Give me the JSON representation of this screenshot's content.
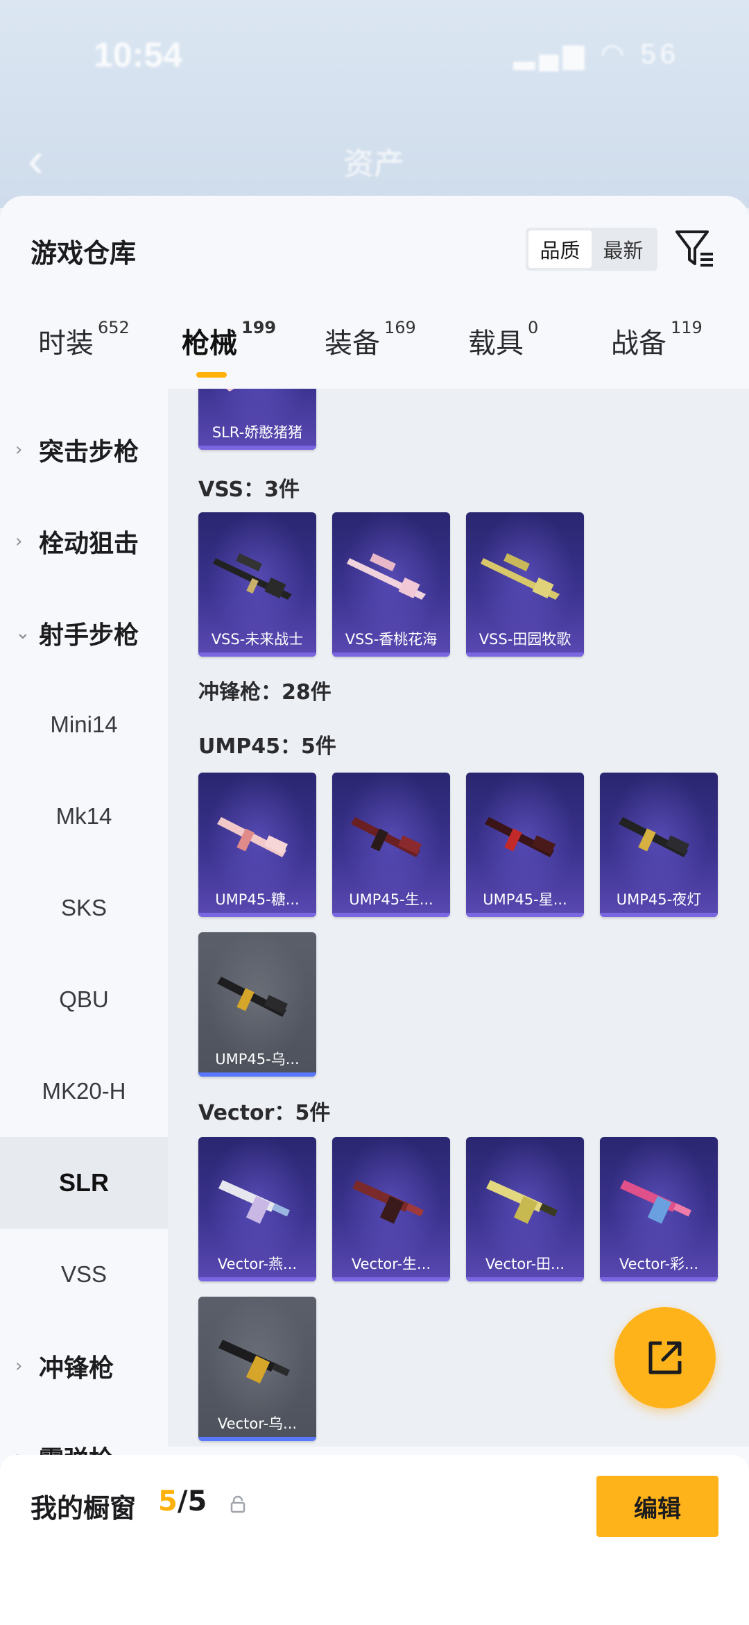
{
  "status_bar": {
    "time": "10:54",
    "right_icons": "▂▄▆ ◠ 56"
  },
  "nav": {
    "back_glyph": "‹",
    "title": "资产"
  },
  "sheet": {
    "title": "游戏仓库",
    "sort": {
      "quality": "品质",
      "newest": "最新"
    }
  },
  "tabs": [
    {
      "label": "时装",
      "count": "652"
    },
    {
      "label": "枪械",
      "count": "199"
    },
    {
      "label": "装备",
      "count": "169"
    },
    {
      "label": "载具",
      "count": "0"
    },
    {
      "label": "战备",
      "count": "119"
    }
  ],
  "sidebar": {
    "items": [
      {
        "label": "突击步枪",
        "chev": "›"
      },
      {
        "label": "栓动狙击",
        "chev": "›"
      },
      {
        "label": "射手步枪",
        "chev": "⌄"
      },
      {
        "label": "Mini14"
      },
      {
        "label": "Mk14"
      },
      {
        "label": "SKS"
      },
      {
        "label": "QBU"
      },
      {
        "label": "MK20-H"
      },
      {
        "label": "SLR"
      },
      {
        "label": "VSS"
      },
      {
        "label": "冲锋枪",
        "chev": "›"
      },
      {
        "label": "霰弹枪",
        "chev": "›"
      }
    ]
  },
  "content": {
    "slr_partial": "SLR-娇憨猪猪",
    "vss_label": "VSS：3件",
    "vss": [
      "VSS-未来战士",
      "VSS-香桃花海",
      "VSS-田园牧歌"
    ],
    "smg_label": "冲锋枪：28件",
    "ump_label": "UMP45：5件",
    "ump": [
      "UMP45-糖...",
      "UMP45-生...",
      "UMP45-星...",
      "UMP45-夜灯",
      "UMP45-乌..."
    ],
    "vector_label": "Vector：5件",
    "vector": [
      "Vector-燕...",
      "Vector-生...",
      "Vector-田...",
      "Vector-彩...",
      "Vector-乌..."
    ]
  },
  "bottom": {
    "title": "我的橱窗",
    "current": "5",
    "total": "/5",
    "edit": "编辑"
  },
  "colors": {
    "accent": "#ffb10a",
    "card_purple": "#3b338f",
    "card_grey": "#4e525c"
  }
}
